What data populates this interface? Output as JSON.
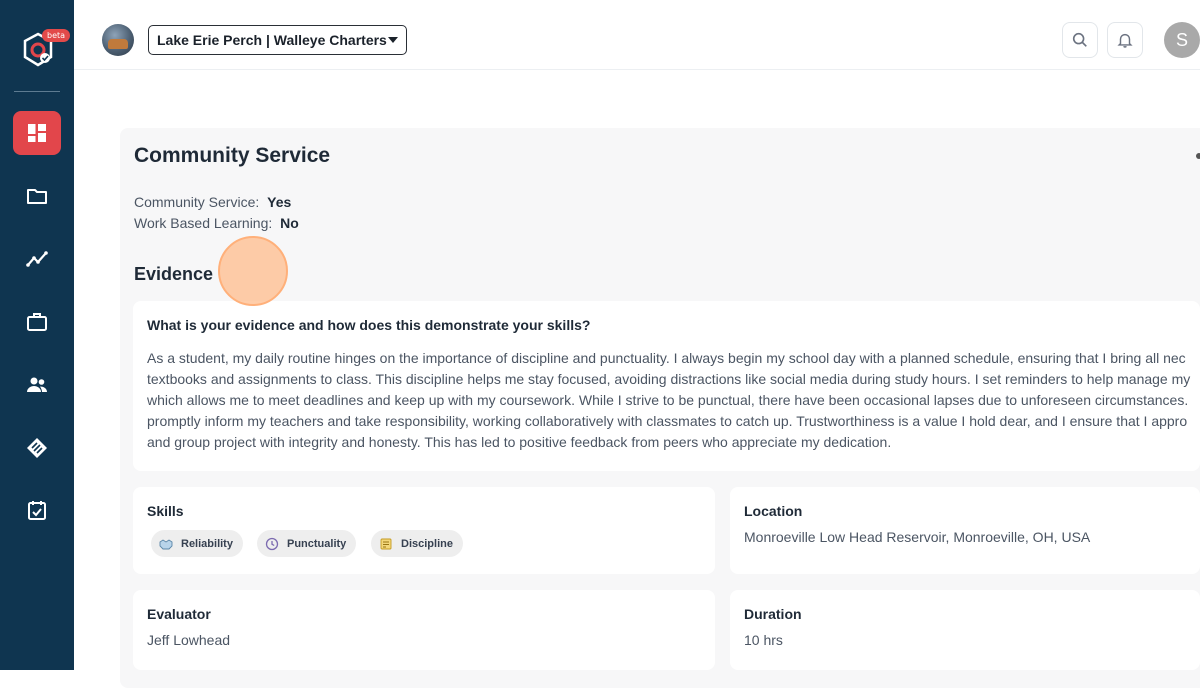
{
  "sidebar": {
    "beta_badge": "beta",
    "items": [
      {
        "icon": "dashboard-icon",
        "active": true
      },
      {
        "icon": "folder-icon",
        "active": false
      },
      {
        "icon": "analytics-icon",
        "active": false
      },
      {
        "icon": "briefcase-icon",
        "active": false
      },
      {
        "icon": "people-icon",
        "active": false
      },
      {
        "icon": "badge-icon",
        "active": false
      },
      {
        "icon": "calendar-check-icon",
        "active": false
      }
    ],
    "colors": {
      "background": "#0f3550",
      "active": "#e2464b"
    }
  },
  "header": {
    "org_selector": "Lake Erie Perch | Walleye Charters",
    "user_initial": "S"
  },
  "main": {
    "title": "Community Service",
    "community_service_label": "Community Service:",
    "community_service_value": "Yes",
    "work_based_learning_label": "Work Based Learning:",
    "work_based_learning_value": "No",
    "evidence_heading": "Evidence",
    "evidence": {
      "question": "What is your evidence and how does this demonstrate your skills?",
      "lines": [
        "As a student, my daily routine hinges on the importance of discipline and punctuality. I always begin my school day with a planned schedule, ensuring that I bring all nec",
        "textbooks and assignments to class. This discipline helps me stay focused, avoiding distractions like social media during study hours. I set reminders to help manage my",
        "which allows me to meet deadlines and keep up with my coursework. While I strive to be punctual, there have been occasional lapses due to unforeseen circumstances.",
        "promptly inform my teachers and take responsibility, working collaboratively with classmates to catch up. Trustworthiness is a value I hold dear, and I ensure that I appro",
        "and group project with integrity and honesty. This has led to positive feedback from peers who appreciate my dedication."
      ]
    },
    "skills": {
      "label": "Skills",
      "items": [
        {
          "name": "Reliability",
          "icon": "handshake-icon"
        },
        {
          "name": "Punctuality",
          "icon": "clock-icon"
        },
        {
          "name": "Discipline",
          "icon": "note-icon"
        }
      ]
    },
    "location": {
      "label": "Location",
      "value": "Monroeville Low Head Reservoir, Monroeville, OH, USA"
    },
    "evaluator": {
      "label": "Evaluator",
      "value": "Jeff Lowhead"
    },
    "duration": {
      "label": "Duration",
      "value": "10 hrs"
    }
  }
}
